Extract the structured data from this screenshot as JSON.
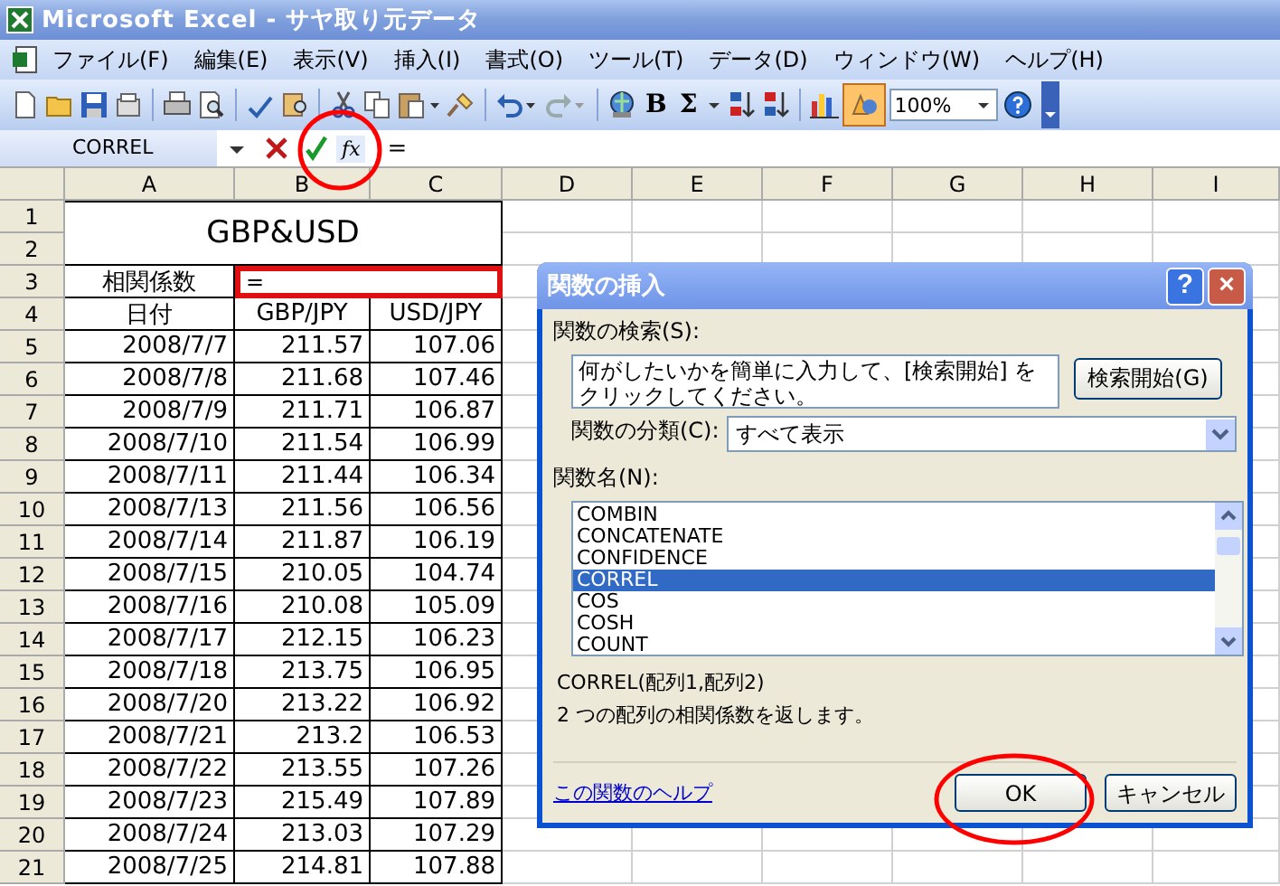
{
  "window": {
    "title": "Microsoft Excel - サヤ取り元データ"
  },
  "menu_bar": [
    "ファイル(F)",
    "編集(E)",
    "表示(V)",
    "挿入(I)",
    "書式(O)",
    "ツール(T)",
    "データ(D)",
    "ウィンドウ(W)",
    "ヘルプ(H)"
  ],
  "toolbar": {
    "bold_button": "B",
    "sum_button": "Σ",
    "zoom": "100%"
  },
  "formula_bar": {
    "name_box": "CORREL",
    "function_button": "fx",
    "formula": "="
  },
  "sheet": {
    "columns": [
      "A",
      "B",
      "C",
      "D",
      "E",
      "F",
      "G",
      "H",
      "I"
    ],
    "row_numbers": [
      "1",
      "2",
      "3",
      "4",
      "5",
      "6",
      "7",
      "8",
      "9",
      "10",
      "11",
      "12",
      "13",
      "14",
      "15",
      "16",
      "17",
      "18",
      "19",
      "20",
      "21"
    ],
    "title": "GBP&USD",
    "label_cell": "相関係数",
    "formula_cell": "=",
    "header": [
      "日付",
      "GBP/JPY",
      "USD/JPY"
    ],
    "rows": [
      {
        "date": "2008/7/7",
        "gbp": "211.57",
        "usd": "107.06"
      },
      {
        "date": "2008/7/8",
        "gbp": "211.68",
        "usd": "107.46"
      },
      {
        "date": "2008/7/9",
        "gbp": "211.71",
        "usd": "106.87"
      },
      {
        "date": "2008/7/10",
        "gbp": "211.54",
        "usd": "106.99"
      },
      {
        "date": "2008/7/11",
        "gbp": "211.44",
        "usd": "106.34"
      },
      {
        "date": "2008/7/13",
        "gbp": "211.56",
        "usd": "106.56"
      },
      {
        "date": "2008/7/14",
        "gbp": "211.87",
        "usd": "106.19"
      },
      {
        "date": "2008/7/15",
        "gbp": "210.05",
        "usd": "104.74"
      },
      {
        "date": "2008/7/16",
        "gbp": "210.08",
        "usd": "105.09"
      },
      {
        "date": "2008/7/17",
        "gbp": "212.15",
        "usd": "106.23"
      },
      {
        "date": "2008/7/18",
        "gbp": "213.75",
        "usd": "106.95"
      },
      {
        "date": "2008/7/20",
        "gbp": "213.22",
        "usd": "106.92"
      },
      {
        "date": "2008/7/21",
        "gbp": "213.2",
        "usd": "106.53"
      },
      {
        "date": "2008/7/22",
        "gbp": "213.55",
        "usd": "107.26"
      },
      {
        "date": "2008/7/23",
        "gbp": "215.49",
        "usd": "107.89"
      },
      {
        "date": "2008/7/24",
        "gbp": "213.03",
        "usd": "107.29"
      },
      {
        "date": "2008/7/25",
        "gbp": "214.81",
        "usd": "107.88"
      }
    ]
  },
  "dialog": {
    "title": "関数の挿入",
    "help_button": "?",
    "close_button": "×",
    "search_label": "関数の検索(S):",
    "search_value": "何がしたいかを簡単に入力して、[検索開始] をクリックしてください。",
    "search_button": "検索開始(G)",
    "category_label": "関数の分類(C):",
    "category_value": "すべて表示",
    "list_label": "関数名(N):",
    "functions": [
      {
        "name": "COMBIN",
        "selected": false
      },
      {
        "name": "CONCATENATE",
        "selected": false
      },
      {
        "name": "CONFIDENCE",
        "selected": false
      },
      {
        "name": "CORREL",
        "selected": true
      },
      {
        "name": "COS",
        "selected": false
      },
      {
        "name": "COSH",
        "selected": false
      },
      {
        "name": "COUNT",
        "selected": false
      }
    ],
    "syntax": "CORREL(配列1,配列2)",
    "description": "2 つの配列の相関係数を返します。",
    "help_link": "この関数のヘルプ",
    "ok_button": "OK",
    "cancel_button": "キャンセル"
  }
}
